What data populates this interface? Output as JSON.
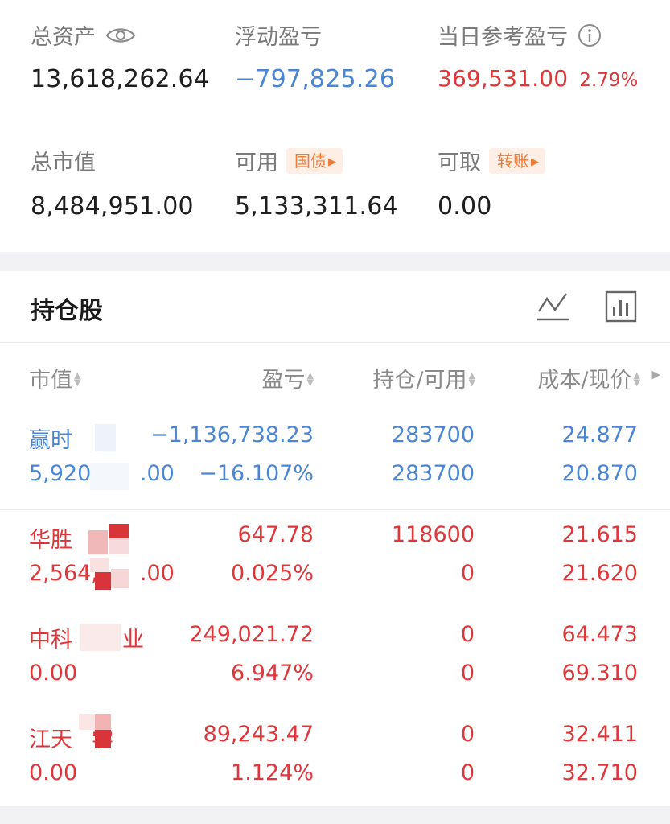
{
  "summary": {
    "total_assets_label": "总资产",
    "total_assets_value": "13,618,262.64",
    "floating_pl_label": "浮动盈亏",
    "floating_pl_value": "−797,825.26",
    "daily_ref_pl_label": "当日参考盈亏",
    "daily_ref_pl_value": "369,531.00",
    "daily_ref_pl_pct": "2.79%",
    "market_value_label": "总市值",
    "market_value_value": "8,484,951.00",
    "available_label": "可用",
    "available_tag": "国债",
    "available_value": "5,133,311.64",
    "withdrawable_label": "可取",
    "withdrawable_tag": "转账",
    "withdrawable_value": "0.00"
  },
  "holdings": {
    "title": "持仓股",
    "columns": [
      "市值",
      "盈亏",
      "持仓/可用",
      "成本/现价"
    ],
    "rows": [
      {
        "name": "赢时",
        "market_value": "5,920,",
        "market_value_tail": ".00",
        "pl": "−1,136,738.23",
        "pl_pct": "−16.107%",
        "position": "283700",
        "available": "283700",
        "cost": "24.877",
        "price": "20.870"
      },
      {
        "name": "华胜",
        "market_value": "2,564,",
        "market_value_tail": ".00",
        "pl": "647.78",
        "pl_pct": "0.025%",
        "position": "118600",
        "available": "0",
        "cost": "21.615",
        "price": "21.620"
      },
      {
        "name": "中科",
        "name_tail": "业",
        "market_value": "0.00",
        "market_value_tail": "",
        "pl": "249,021.72",
        "pl_pct": "6.947%",
        "position": "0",
        "available": "0",
        "cost": "64.473",
        "price": "69.310"
      },
      {
        "name": "江天",
        "name_tail": "学",
        "market_value": "0.00",
        "market_value_tail": "",
        "pl": "89,243.47",
        "pl_pct": "1.124%",
        "position": "0",
        "available": "0",
        "cost": "32.411",
        "price": "32.710"
      }
    ]
  },
  "colors": {
    "loss": "#4a86d4",
    "profit": "#e0363a",
    "tag": "#f07a36"
  },
  "icons": [
    "eye-icon",
    "info-icon",
    "trend-line-icon",
    "bar-chart-icon",
    "sort-icon",
    "chevron-right-icon"
  ]
}
